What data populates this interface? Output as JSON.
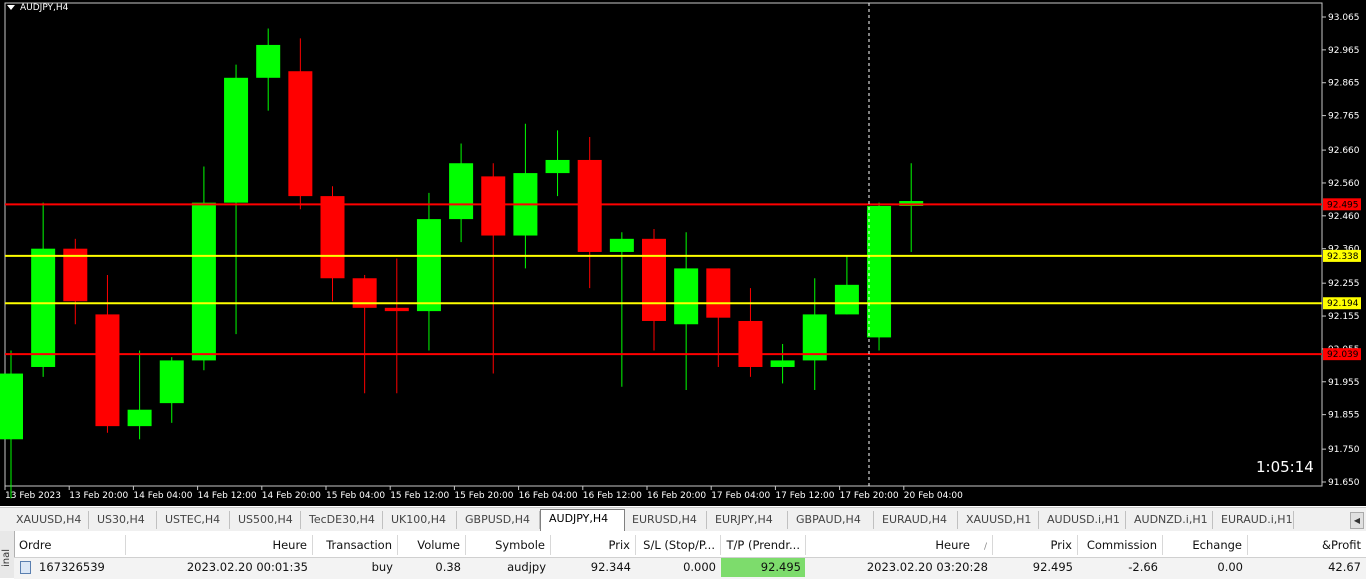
{
  "chart": {
    "title": "AUDJPY,H4",
    "countdown": "1:05:14",
    "price_ticks": [
      "93.065",
      "92.965",
      "92.865",
      "92.765",
      "92.660",
      "92.560",
      "92.460",
      "92.360",
      "92.255",
      "92.155",
      "92.055",
      "91.955",
      "91.855",
      "91.750",
      "91.650"
    ],
    "time_labels": [
      "13 Feb 2023",
      "13 Feb 20:00",
      "14 Feb 04:00",
      "14 Feb 12:00",
      "14 Feb 20:00",
      "15 Feb 04:00",
      "15 Feb 12:00",
      "15 Feb 20:00",
      "16 Feb 04:00",
      "16 Feb 12:00",
      "16 Feb 20:00",
      "17 Feb 04:00",
      "17 Feb 12:00",
      "17 Feb 20:00",
      "20 Feb 04:00"
    ],
    "levels": [
      {
        "label": "92.495",
        "price": 92.495,
        "color": "#ff0000"
      },
      {
        "label": "92.338",
        "price": 92.338,
        "color": "#ffff00"
      },
      {
        "label": "92.194",
        "price": 92.194,
        "color": "#ffff00"
      },
      {
        "label": "92.039",
        "price": 92.039,
        "color": "#ff0000"
      }
    ],
    "bull_color": "#00ff00",
    "bear_color": "#ff0000"
  },
  "chart_data": {
    "type": "candlestick",
    "symbol": "AUDJPY",
    "timeframe": "H4",
    "ylim": [
      91.65,
      93.065
    ],
    "candles": [
      {
        "o": 91.78,
        "h": 92.05,
        "l": 91.6,
        "c": 91.98
      },
      {
        "o": 92.0,
        "h": 92.5,
        "l": 91.97,
        "c": 92.36
      },
      {
        "o": 92.36,
        "h": 92.39,
        "l": 92.13,
        "c": 92.2
      },
      {
        "o": 92.16,
        "h": 92.28,
        "l": 91.8,
        "c": 91.82
      },
      {
        "o": 91.82,
        "h": 92.05,
        "l": 91.78,
        "c": 91.87
      },
      {
        "o": 91.89,
        "h": 92.03,
        "l": 91.83,
        "c": 92.02
      },
      {
        "o": 92.02,
        "h": 92.61,
        "l": 91.99,
        "c": 92.5
      },
      {
        "o": 92.5,
        "h": 92.92,
        "l": 92.1,
        "c": 92.88
      },
      {
        "o": 92.88,
        "h": 93.03,
        "l": 92.78,
        "c": 92.98
      },
      {
        "o": 92.9,
        "h": 93.0,
        "l": 92.48,
        "c": 92.52
      },
      {
        "o": 92.52,
        "h": 92.55,
        "l": 92.2,
        "c": 92.27
      },
      {
        "o": 92.27,
        "h": 92.28,
        "l": 91.92,
        "c": 92.18
      },
      {
        "o": 92.18,
        "h": 92.33,
        "l": 91.92,
        "c": 92.17
      },
      {
        "o": 92.17,
        "h": 92.53,
        "l": 92.05,
        "c": 92.45
      },
      {
        "o": 92.45,
        "h": 92.68,
        "l": 92.38,
        "c": 92.62
      },
      {
        "o": 92.58,
        "h": 92.62,
        "l": 91.98,
        "c": 92.4
      },
      {
        "o": 92.4,
        "h": 92.74,
        "l": 92.3,
        "c": 92.59
      },
      {
        "o": 92.59,
        "h": 92.72,
        "l": 92.52,
        "c": 92.63
      },
      {
        "o": 92.63,
        "h": 92.7,
        "l": 92.24,
        "c": 92.35
      },
      {
        "o": 92.35,
        "h": 92.41,
        "l": 91.94,
        "c": 92.39
      },
      {
        "o": 92.39,
        "h": 92.42,
        "l": 92.05,
        "c": 92.14
      },
      {
        "o": 92.13,
        "h": 92.41,
        "l": 91.93,
        "c": 92.3
      },
      {
        "o": 92.3,
        "h": 92.3,
        "l": 92.0,
        "c": 92.15
      },
      {
        "o": 92.14,
        "h": 92.24,
        "l": 91.97,
        "c": 92.0
      },
      {
        "o": 92.0,
        "h": 92.07,
        "l": 91.95,
        "c": 92.02
      },
      {
        "o": 92.02,
        "h": 92.27,
        "l": 91.93,
        "c": 92.16
      },
      {
        "o": 92.16,
        "h": 92.34,
        "l": 92.16,
        "c": 92.25
      },
      {
        "o": 92.09,
        "h": 92.5,
        "l": 92.05,
        "c": 92.49
      },
      {
        "o": 92.49,
        "h": 92.62,
        "l": 92.35,
        "c": 92.505
      }
    ],
    "horizontal_levels": [
      92.495,
      92.338,
      92.194,
      92.039
    ]
  },
  "tabs": [
    {
      "label": "XAUUSD,H4",
      "active": false
    },
    {
      "label": "US30,H4",
      "active": false
    },
    {
      "label": "USTEC,H4",
      "active": false
    },
    {
      "label": "US500,H4",
      "active": false
    },
    {
      "label": "TecDE30,H4",
      "active": false
    },
    {
      "label": "UK100,H4",
      "active": false
    },
    {
      "label": "GBPUSD,H4",
      "active": false
    },
    {
      "label": "AUDJPY,H4",
      "active": true
    },
    {
      "label": "EURUSD,H4",
      "active": false
    },
    {
      "label": "EURJPY,H4",
      "active": false
    },
    {
      "label": "GBPAUD,H4",
      "active": false
    },
    {
      "label": "EURAUD,H4",
      "active": false
    },
    {
      "label": "XAUUSD,H1",
      "active": false
    },
    {
      "label": "AUDUSD.i,H1",
      "active": false
    },
    {
      "label": "AUDNZD.i,H1",
      "active": false
    },
    {
      "label": "EURAUD.i,H1",
      "active": false
    }
  ],
  "terminal": {
    "side_label": "inal",
    "headers": {
      "ordre": "Ordre",
      "heure": "Heure",
      "transaction": "Transaction",
      "volume": "Volume",
      "symbole": "Symbole",
      "prix": "Prix",
      "sl": "S/L (Stop/P...",
      "tp": "T/P (Prendr...",
      "heure2": "Heure",
      "sort": "/",
      "prix2": "Prix",
      "commission": "Commission",
      "echange": "Echange",
      "profit": "&Profit"
    },
    "row": {
      "ordre": "167326539",
      "heure": "2023.02.20 00:01:35",
      "transaction": "buy",
      "volume": "0.38",
      "symbole": "audjpy",
      "prix": "92.344",
      "sl": "0.000",
      "tp": "92.495",
      "heure2": "2023.02.20 03:20:28",
      "prix2": "92.495",
      "commission": "-2.66",
      "echange": "0.00",
      "profit": "42.67"
    }
  }
}
